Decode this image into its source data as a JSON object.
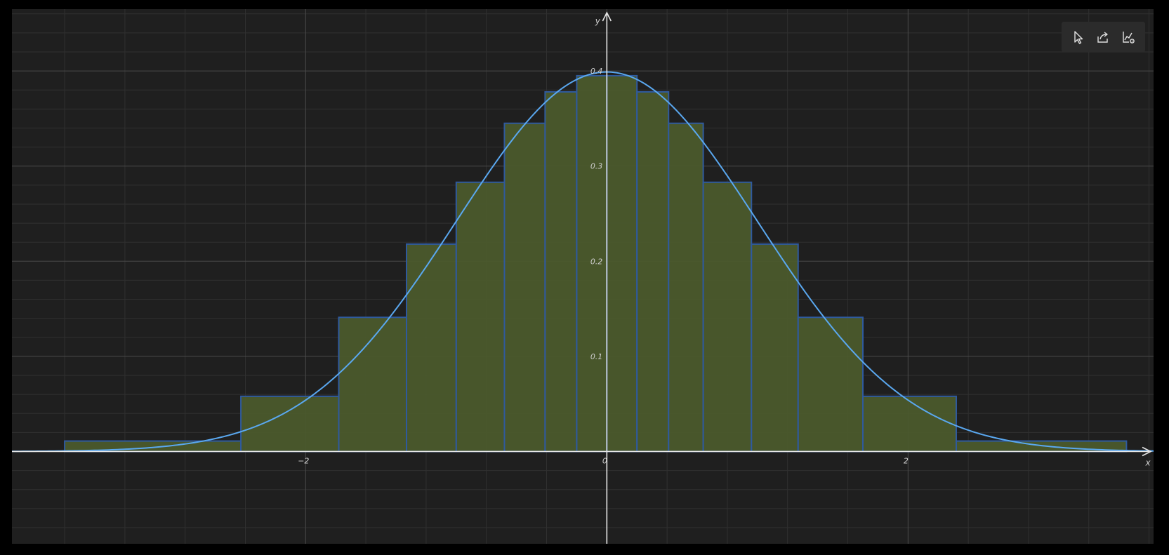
{
  "toolbar": {
    "buttons": [
      {
        "name": "select-tool-button",
        "icon": "cursor-arrow-icon"
      },
      {
        "name": "share-button",
        "icon": "share-export-icon"
      },
      {
        "name": "graph-settings-button",
        "icon": "graph-settings-icon"
      }
    ]
  },
  "colors": {
    "background": "#1f1f1f",
    "grid_major": "#4a4a4a",
    "grid_minor": "#303030",
    "axis": "#e6e6e6",
    "bar_fill": "#4b5a2c",
    "bar_stroke": "#2f5a9e",
    "curve": "#5aa8f0"
  },
  "chart_data": {
    "type": "bar",
    "title": "",
    "xlabel": "x",
    "ylabel": "y",
    "xlim": [
      -3.95,
      3.63
    ],
    "ylim": [
      -0.097,
      0.465
    ],
    "x_ticks": [
      {
        "value": -2,
        "label": "−2"
      },
      {
        "value": 0,
        "label": "0"
      },
      {
        "value": 2,
        "label": "2"
      }
    ],
    "y_ticks": [
      {
        "value": 0.1,
        "label": "0.1"
      },
      {
        "value": 0.2,
        "label": "0.2"
      },
      {
        "value": 0.3,
        "label": "0.3"
      },
      {
        "value": 0.4,
        "label": "0.4"
      }
    ],
    "grid": true,
    "bars": [
      {
        "x0": -3.6,
        "x1": -2.43,
        "value": 0.011
      },
      {
        "x0": -2.43,
        "x1": -1.78,
        "value": 0.058
      },
      {
        "x0": -1.78,
        "x1": -1.33,
        "value": 0.141
      },
      {
        "x0": -1.33,
        "x1": -1.0,
        "value": 0.218
      },
      {
        "x0": -1.0,
        "x1": -0.68,
        "value": 0.283
      },
      {
        "x0": -0.68,
        "x1": -0.41,
        "value": 0.345
      },
      {
        "x0": -0.41,
        "x1": -0.2,
        "value": 0.378
      },
      {
        "x0": -0.2,
        "x1": 0.0,
        "value": 0.395
      },
      {
        "x0": 0.0,
        "x1": 0.2,
        "value": 0.395
      },
      {
        "x0": 0.2,
        "x1": 0.41,
        "value": 0.378
      },
      {
        "x0": 0.41,
        "x1": 0.64,
        "value": 0.345
      },
      {
        "x0": 0.64,
        "x1": 0.96,
        "value": 0.283
      },
      {
        "x0": 0.96,
        "x1": 1.27,
        "value": 0.218
      },
      {
        "x0": 1.27,
        "x1": 1.7,
        "value": 0.141
      },
      {
        "x0": 1.7,
        "x1": 2.32,
        "value": 0.058
      },
      {
        "x0": 2.32,
        "x1": 3.45,
        "value": 0.011
      }
    ],
    "curve": {
      "type": "normal-pdf",
      "mean": 0,
      "sd": 1
    }
  }
}
